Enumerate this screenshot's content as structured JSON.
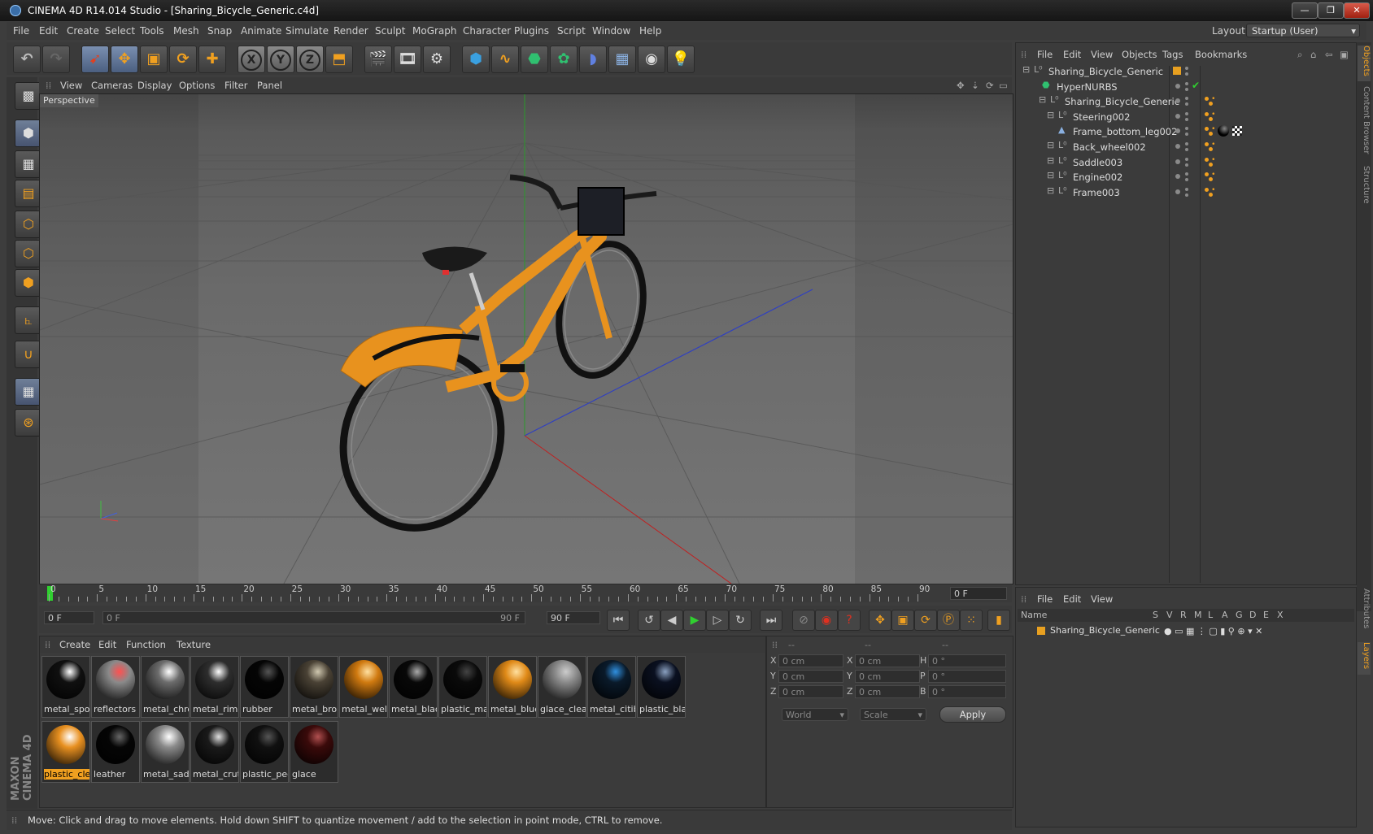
{
  "window": {
    "title": "CINEMA 4D R14.014 Studio - [Sharing_Bicycle_Generic.c4d]",
    "min": "—",
    "max": "❐",
    "close": "✕"
  },
  "menubar": [
    "File",
    "Edit",
    "Create",
    "Select",
    "Tools",
    "Mesh",
    "Snap",
    "Animate",
    "Simulate",
    "Render",
    "Sculpt",
    "MoGraph",
    "Character",
    "Plugins",
    "Script",
    "Window",
    "Help"
  ],
  "layout": {
    "label": "Layout:",
    "value": "Startup (User)"
  },
  "toolbar": {
    "x": "X",
    "y": "Y",
    "z": "Z"
  },
  "viewport": {
    "menu": [
      "View",
      "Cameras",
      "Display",
      "Options",
      "Filter",
      "Panel"
    ],
    "label": "Perspective"
  },
  "timeline": {
    "ticks": [
      "0",
      "5",
      "10",
      "15",
      "20",
      "25",
      "30",
      "35",
      "40",
      "45",
      "50",
      "55",
      "60",
      "65",
      "70",
      "75",
      "80",
      "85",
      "90"
    ],
    "current_frame": "0 F",
    "start_frame": "0 F",
    "range_start": "0 F",
    "range_end": "90 F",
    "end_frame": "90 F"
  },
  "materials": {
    "menu": [
      "Create",
      "Edit",
      "Function",
      "Texture"
    ],
    "items": [
      {
        "label": "metal_spok",
        "color": "#101010",
        "hl": "#ffffff"
      },
      {
        "label": "reflectors",
        "color": "#8a8a8a",
        "hl": "#ff5050"
      },
      {
        "label": "metal_chro",
        "color": "#6c6c6c",
        "hl": "#ffffff"
      },
      {
        "label": "metal_rim",
        "color": "#2e2e2e",
        "hl": "#ffffff"
      },
      {
        "label": "rubber",
        "color": "#050505",
        "hl": "#555555"
      },
      {
        "label": "metal_bror",
        "color": "#4a4235",
        "hl": "#d0c8b0"
      },
      {
        "label": "metal_welc",
        "color": "#d07a10",
        "hl": "#ffe0a0"
      },
      {
        "label": "metal_blacl",
        "color": "#080808",
        "hl": "#aaaaaa"
      },
      {
        "label": "plastic_mat",
        "color": "#0a0a0a",
        "hl": "#444444"
      },
      {
        "label": "metal_blue",
        "color": "#e08a18",
        "hl": "#ffe0a0"
      },
      {
        "label": "glace_clear",
        "color": "#8a8a8a",
        "hl": "#cccccc"
      },
      {
        "label": "metal_citib",
        "color": "#0a1a2a",
        "hl": "#3090e0"
      },
      {
        "label": "plastic_blac",
        "color": "#0a1020",
        "hl": "#8aa0c0"
      },
      {
        "label": "plastic_clea",
        "color": "#e89020",
        "hl": "#ffffff"
      },
      {
        "label": "leather",
        "color": "#050505",
        "hl": "#666666"
      },
      {
        "label": "metal_sadc",
        "color": "#8a8a8a",
        "hl": "#ffffff"
      },
      {
        "label": "metal_crutc",
        "color": "#1a1a1a",
        "hl": "#e0e0e0"
      },
      {
        "label": "plastic_pec",
        "color": "#101010",
        "hl": "#555555"
      },
      {
        "label": "glace",
        "color": "#3a0a0a",
        "hl": "#b05050"
      }
    ]
  },
  "coords": {
    "headers": [
      "--",
      "--",
      "--"
    ],
    "rows": [
      {
        "a": "X",
        "av": "0 cm",
        "b": "X",
        "bv": "0 cm",
        "c": "H",
        "cv": "0 °"
      },
      {
        "a": "Y",
        "av": "0 cm",
        "b": "Y",
        "bv": "0 cm",
        "c": "P",
        "cv": "0 °"
      },
      {
        "a": "Z",
        "av": "0 cm",
        "b": "Z",
        "bv": "0 cm",
        "c": "B",
        "cv": "0 °"
      }
    ],
    "space": "World",
    "mode": "Scale",
    "apply": "Apply"
  },
  "objects": {
    "menu": [
      "File",
      "Edit",
      "View",
      "Objects",
      "Tags",
      "Bookmarks"
    ],
    "tree": [
      {
        "name": "Sharing_Bicycle_Generic",
        "indent": 0
      },
      {
        "name": "HyperNURBS",
        "indent": 1
      },
      {
        "name": "Sharing_Bicycle_Generic",
        "indent": 2
      },
      {
        "name": "Steering002",
        "indent": 3
      },
      {
        "name": "Frame_bottom_leg002",
        "indent": 3
      },
      {
        "name": "Back_wheel002",
        "indent": 3
      },
      {
        "name": "Saddle003",
        "indent": 3
      },
      {
        "name": "Engine002",
        "indent": 3
      },
      {
        "name": "Frame003",
        "indent": 3
      }
    ]
  },
  "layers": {
    "menu": [
      "File",
      "Edit",
      "View"
    ],
    "col_name": "Name",
    "cols": [
      "S",
      "V",
      "R",
      "M",
      "L",
      "A",
      "G",
      "D",
      "E",
      "X"
    ],
    "row": "Sharing_Bicycle_Generic"
  },
  "side_tabs": [
    "Objects",
    "Content Browser",
    "Structure",
    "Attributes",
    "Layers"
  ],
  "status": "Move: Click and drag to move elements. Hold down SHIFT to quantize movement / add to the selection in point mode, CTRL to remove.",
  "brand": "MAXON CINEMA 4D",
  "colors": {
    "accent": "#f0a020",
    "bike": "#e8921e"
  }
}
